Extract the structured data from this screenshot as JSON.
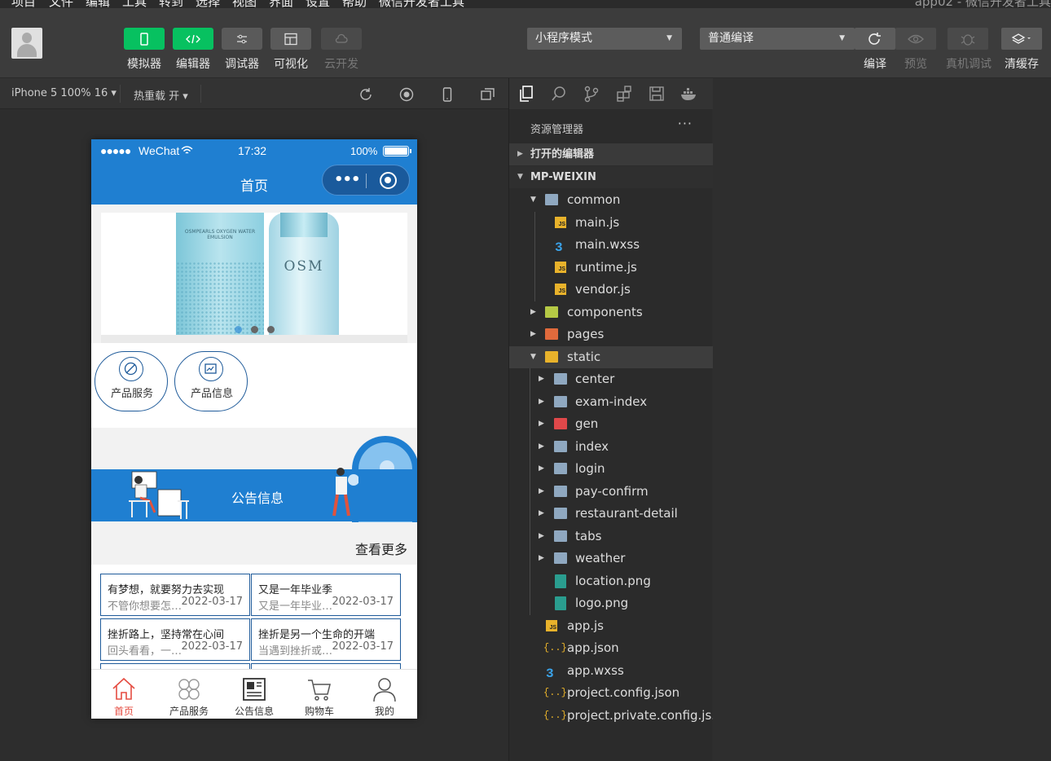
{
  "menu": [
    "项目",
    "文件",
    "编辑",
    "工具",
    "转到",
    "选择",
    "视图",
    "界面",
    "设置",
    "帮助",
    "微信开发者工具"
  ],
  "window_title": "app02 - 微信开发者工具",
  "toolbar": {
    "left_buttons": [
      {
        "label": "模拟器",
        "icon": "phone-icon"
      },
      {
        "label": "编辑器",
        "icon": "code-icon"
      },
      {
        "label": "调试器",
        "icon": "debug-sliders-icon"
      },
      {
        "label": "可视化",
        "icon": "layout-icon"
      },
      {
        "label": "云开发",
        "icon": "cloud-icon"
      }
    ],
    "mode_select": "小程序模式",
    "compile_select": "普通编译",
    "right_buttons": [
      {
        "label": "编译",
        "icon": "refresh-icon"
      },
      {
        "label": "预览",
        "icon": "eye-icon"
      },
      {
        "label": "真机调试",
        "icon": "bug-icon"
      },
      {
        "label": "清缓存",
        "icon": "layers-icon"
      }
    ]
  },
  "simulator_bar": {
    "device": "iPhone 5 100% 16 ▾",
    "hot_reload": "热重载 开 ▾"
  },
  "phone": {
    "status": {
      "carrier": "WeChat",
      "time": "17:32",
      "battery": "100%"
    },
    "nav_title": "首页",
    "banner": {
      "brand": "OSM",
      "label": "OSMPEARLS OXYGEN WATER EMULSION"
    },
    "categories": [
      "产品服务",
      "产品信息"
    ],
    "notice_title": "公告信息",
    "more": "查看更多",
    "cards": [
      {
        "title": "有梦想，就要努力去实现",
        "summary": "不管你想要怎样的生活",
        "date": "2022-03-17"
      },
      {
        "title": "又是一年毕业季",
        "summary": "又是一年毕业季的到来",
        "date": "2022-03-17"
      },
      {
        "title": "挫折路上，坚持常在心间",
        "summary": "回头看看，一路走来",
        "date": "2022-03-17"
      },
      {
        "title": "挫折是另一个生命的开端",
        "summary": "当遇到挫折或失败时",
        "date": "2022-03-17"
      }
    ],
    "tabs": [
      "首页",
      "产品服务",
      "公告信息",
      "购物车",
      "我的"
    ]
  },
  "explorer": {
    "title": "资源管理器",
    "more": "···",
    "open_editors": "打开的编辑器",
    "root": "MP-WEIXIN",
    "tree": [
      {
        "name": "common",
        "type": "folder-open",
        "depth": 1
      },
      {
        "name": "main.js",
        "type": "js",
        "depth": 2
      },
      {
        "name": "main.wxss",
        "type": "css",
        "depth": 2
      },
      {
        "name": "runtime.js",
        "type": "js",
        "depth": 2
      },
      {
        "name": "vendor.js",
        "type": "js",
        "depth": 2
      },
      {
        "name": "components",
        "type": "folder-components",
        "depth": 1
      },
      {
        "name": "pages",
        "type": "folder-pages",
        "depth": 1
      },
      {
        "name": "static",
        "type": "folder-static",
        "depth": 1
      },
      {
        "name": "center",
        "type": "folder",
        "depth": 2
      },
      {
        "name": "exam-index",
        "type": "folder",
        "depth": 2
      },
      {
        "name": "gen",
        "type": "folder-gen",
        "depth": 2
      },
      {
        "name": "index",
        "type": "folder",
        "depth": 2
      },
      {
        "name": "login",
        "type": "folder",
        "depth": 2
      },
      {
        "name": "pay-confirm",
        "type": "folder",
        "depth": 2
      },
      {
        "name": "restaurant-detail",
        "type": "folder",
        "depth": 2
      },
      {
        "name": "tabs",
        "type": "folder",
        "depth": 2
      },
      {
        "name": "weather",
        "type": "folder",
        "depth": 2
      },
      {
        "name": "location.png",
        "type": "image",
        "depth": 2
      },
      {
        "name": "logo.png",
        "type": "image",
        "depth": 2
      },
      {
        "name": "app.js",
        "type": "js",
        "depth": 1
      },
      {
        "name": "app.json",
        "type": "json",
        "depth": 1
      },
      {
        "name": "app.wxss",
        "type": "css",
        "depth": 1
      },
      {
        "name": "project.config.json",
        "type": "json",
        "depth": 1
      },
      {
        "name": "project.private.config.js...",
        "type": "json",
        "depth": 1
      }
    ]
  },
  "colors": {
    "accent_green": "#07c160",
    "wechat_blue": "#1f7fd1",
    "active_tab": "#e54d42"
  }
}
